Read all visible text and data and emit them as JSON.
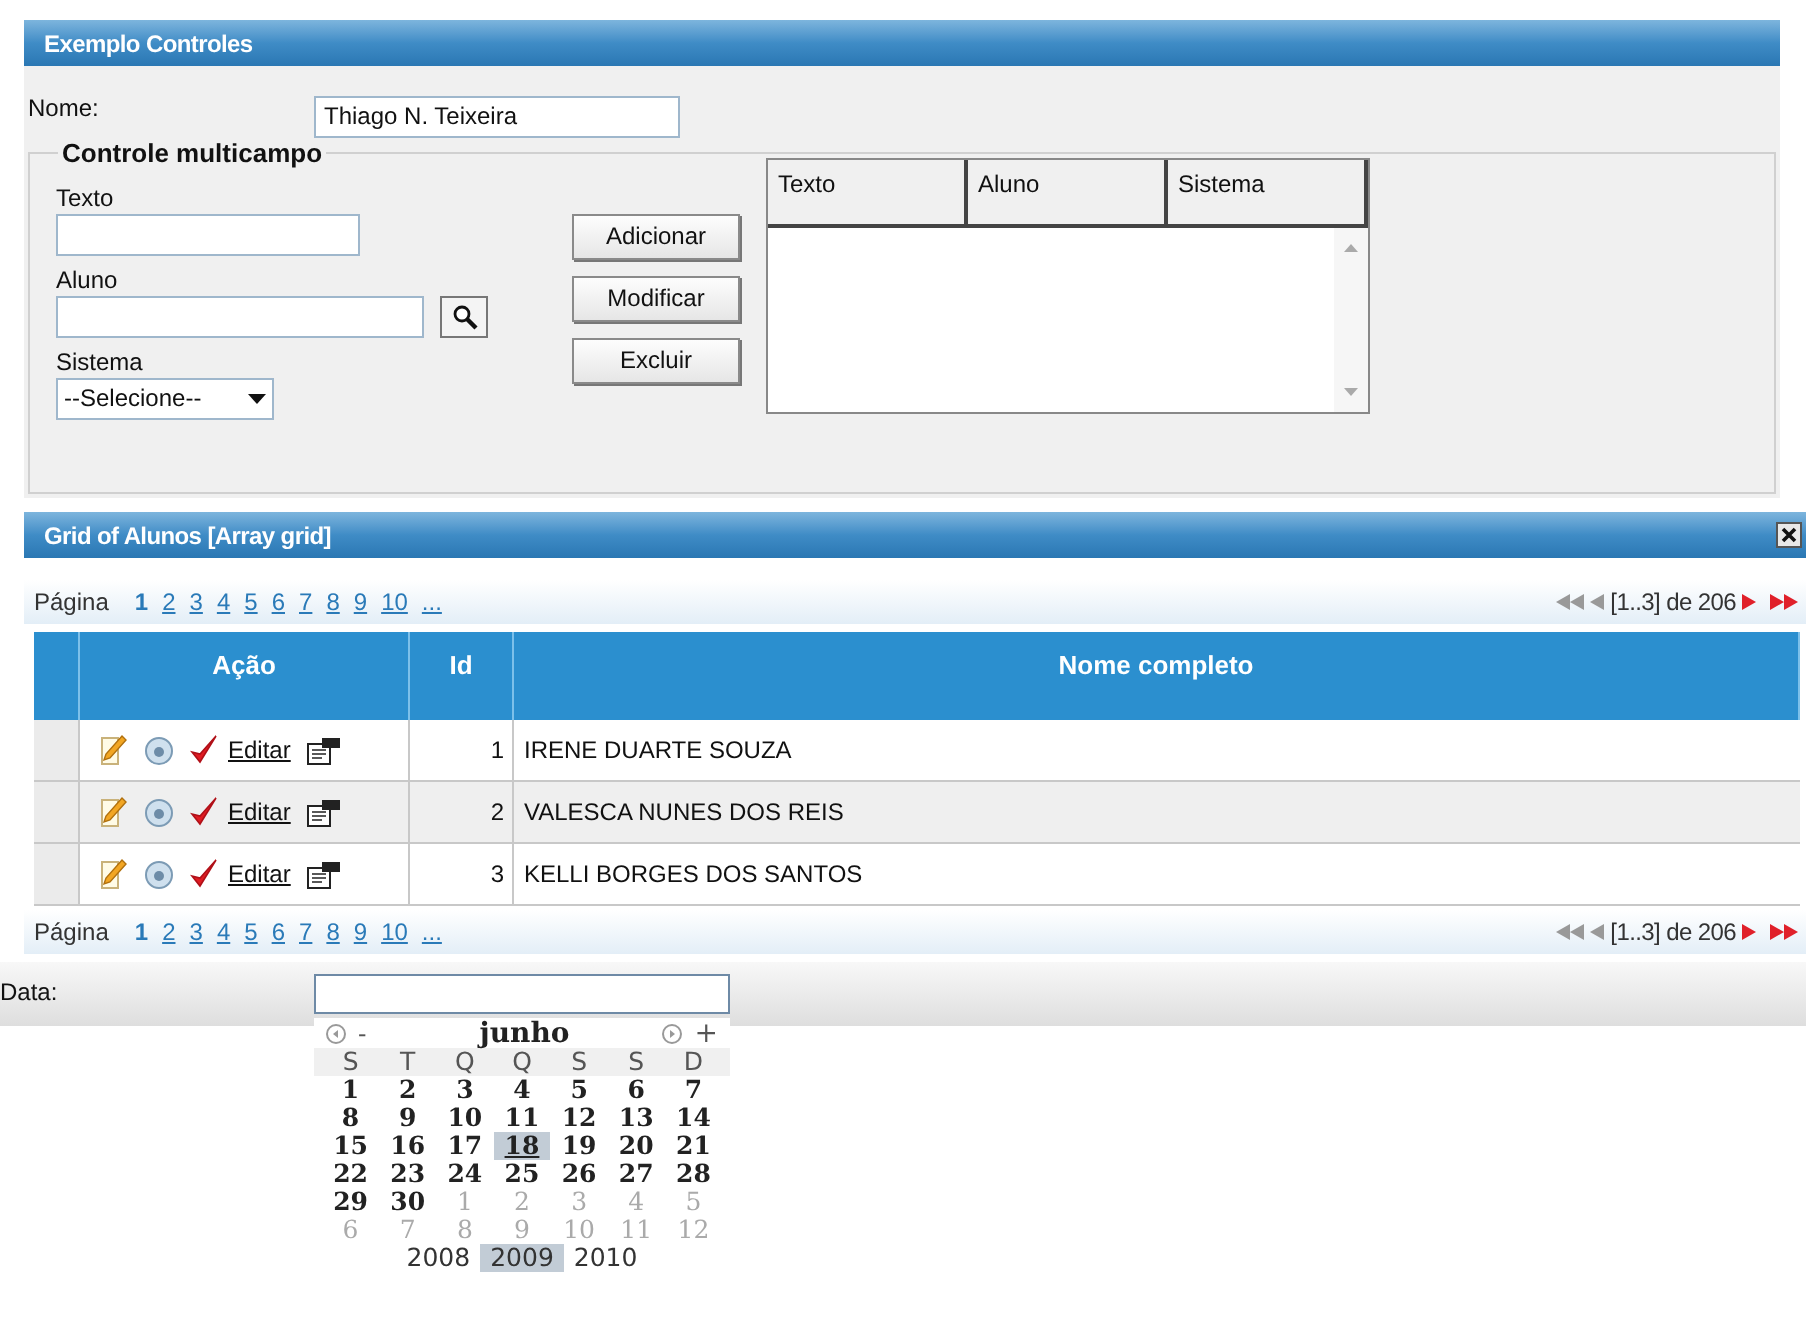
{
  "window": {
    "title": "Exemplo Controles"
  },
  "nome": {
    "label": "Nome:",
    "value": "Thiago N. Teixeira"
  },
  "multicampo": {
    "legend": "Controle multicampo",
    "fields": [
      {
        "label": "Texto",
        "kind": "text"
      },
      {
        "label": "Aluno",
        "kind": "lookup"
      },
      {
        "label": "Sistema",
        "kind": "select",
        "value": "--Selecione--"
      }
    ],
    "buttons": [
      "Adicionar",
      "Modificar",
      "Excluir"
    ],
    "list_columns": [
      "Texto",
      "Aluno",
      "Sistema"
    ]
  },
  "grid": {
    "title": "Grid of Alunos [Array grid]",
    "pager_label": "Página",
    "pages": [
      {
        "label": "1",
        "selected": true
      },
      {
        "label": "2",
        "selected": false
      },
      {
        "label": "3",
        "selected": false
      },
      {
        "label": "4",
        "selected": false
      },
      {
        "label": "5",
        "selected": false
      },
      {
        "label": "6",
        "selected": false
      },
      {
        "label": "7",
        "selected": false
      },
      {
        "label": "8",
        "selected": false
      },
      {
        "label": "9",
        "selected": false
      },
      {
        "label": "10",
        "selected": false
      },
      {
        "label": "...",
        "selected": false
      }
    ],
    "summary": "[1..3] de 206",
    "pager_bottom_label": "Página",
    "pages_bottom": [
      {
        "label": "1",
        "selected": true
      },
      {
        "label": "2",
        "selected": false
      },
      {
        "label": "3",
        "selected": false
      },
      {
        "label": "4",
        "selected": false
      },
      {
        "label": "5",
        "selected": false
      },
      {
        "label": "6",
        "selected": false
      },
      {
        "label": "7",
        "selected": false
      },
      {
        "label": "8",
        "selected": false
      },
      {
        "label": "9",
        "selected": false
      },
      {
        "label": "10",
        "selected": false
      },
      {
        "label": "...",
        "selected": false
      }
    ],
    "summary_bottom": "[1..3] de 206",
    "columns": [
      "Ação",
      "Id",
      "Nome completo"
    ],
    "rows": [
      {
        "action": "Editar",
        "id": "1",
        "name": "IRENE DUARTE SOUZA"
      },
      {
        "action": "Editar",
        "id": "2",
        "name": "VALESCA NUNES DOS REIS"
      },
      {
        "action": "Editar",
        "id": "3",
        "name": "KELLI BORGES DOS SANTOS"
      }
    ]
  },
  "date": {
    "label": "Data:",
    "calendar": {
      "prev": "-",
      "month": "junho",
      "next": "+",
      "weekdays": [
        "S",
        "T",
        "Q",
        "Q",
        "S",
        "S",
        "D"
      ],
      "weeks": [
        [
          {
            "day": "1",
            "other_month": false,
            "selected": false
          },
          {
            "day": "2",
            "other_month": false,
            "selected": false
          },
          {
            "day": "3",
            "other_month": false,
            "selected": false
          },
          {
            "day": "4",
            "other_month": false,
            "selected": false
          },
          {
            "day": "5",
            "other_month": false,
            "selected": false
          },
          {
            "day": "6",
            "other_month": false,
            "selected": false
          },
          {
            "day": "7",
            "other_month": false,
            "selected": false
          }
        ],
        [
          {
            "day": "8",
            "other_month": false,
            "selected": false
          },
          {
            "day": "9",
            "other_month": false,
            "selected": false
          },
          {
            "day": "10",
            "other_month": false,
            "selected": false
          },
          {
            "day": "11",
            "other_month": false,
            "selected": false
          },
          {
            "day": "12",
            "other_month": false,
            "selected": false
          },
          {
            "day": "13",
            "other_month": false,
            "selected": false
          },
          {
            "day": "14",
            "other_month": false,
            "selected": false
          }
        ],
        [
          {
            "day": "15",
            "other_month": false,
            "selected": false
          },
          {
            "day": "16",
            "other_month": false,
            "selected": false
          },
          {
            "day": "17",
            "other_month": false,
            "selected": false
          },
          {
            "day": "18",
            "other_month": false,
            "selected": true
          },
          {
            "day": "19",
            "other_month": false,
            "selected": false
          },
          {
            "day": "20",
            "other_month": false,
            "selected": false
          },
          {
            "day": "21",
            "other_month": false,
            "selected": false
          }
        ],
        [
          {
            "day": "22",
            "other_month": false,
            "selected": false
          },
          {
            "day": "23",
            "other_month": false,
            "selected": false
          },
          {
            "day": "24",
            "other_month": false,
            "selected": false
          },
          {
            "day": "25",
            "other_month": false,
            "selected": false
          },
          {
            "day": "26",
            "other_month": false,
            "selected": false
          },
          {
            "day": "27",
            "other_month": false,
            "selected": false
          },
          {
            "day": "28",
            "other_month": false,
            "selected": false
          }
        ],
        [
          {
            "day": "29",
            "other_month": false,
            "selected": false
          },
          {
            "day": "30",
            "other_month": false,
            "selected": false
          },
          {
            "day": "1",
            "other_month": true,
            "selected": false
          },
          {
            "day": "2",
            "other_month": true,
            "selected": false
          },
          {
            "day": "3",
            "other_month": true,
            "selected": false
          },
          {
            "day": "4",
            "other_month": true,
            "selected": false
          },
          {
            "day": "5",
            "other_month": true,
            "selected": false
          }
        ],
        [
          {
            "day": "6",
            "other_month": true,
            "selected": false
          },
          {
            "day": "7",
            "other_month": true,
            "selected": false
          },
          {
            "day": "8",
            "other_month": true,
            "selected": false
          },
          {
            "day": "9",
            "other_month": true,
            "selected": false
          },
          {
            "day": "10",
            "other_month": true,
            "selected": false
          },
          {
            "day": "11",
            "other_month": true,
            "selected": false
          },
          {
            "day": "12",
            "other_month": true,
            "selected": false
          }
        ]
      ],
      "years": [
        {
          "label": "2008",
          "selected": false
        },
        {
          "label": "2009",
          "selected": true
        },
        {
          "label": "2010",
          "selected": false
        }
      ]
    }
  }
}
